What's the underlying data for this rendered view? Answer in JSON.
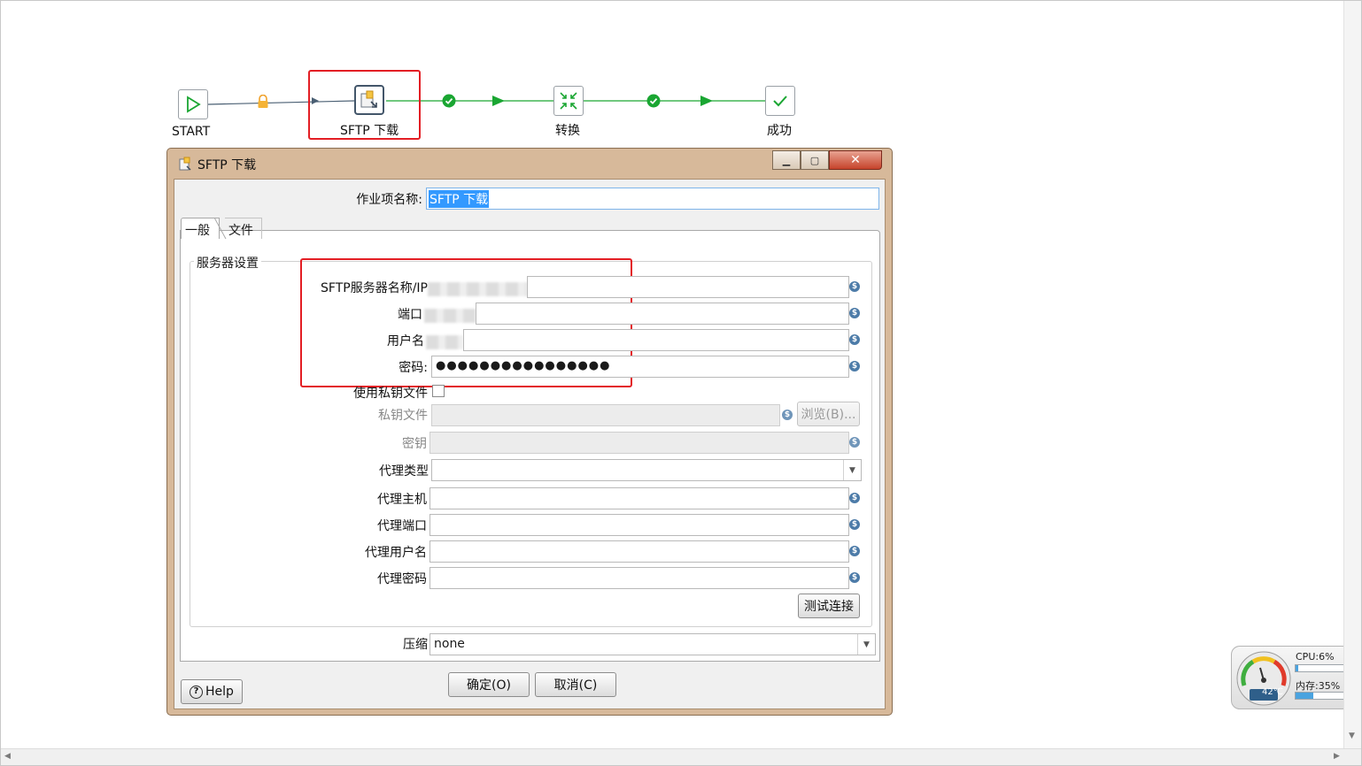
{
  "workflow": {
    "nodes": [
      {
        "label": "START",
        "icon": "play-icon"
      },
      {
        "label": "SFTP 下载",
        "icon": "sftp-download-icon"
      },
      {
        "label": "转换",
        "icon": "transform-icon"
      },
      {
        "label": "成功",
        "icon": "checkmark-icon"
      }
    ]
  },
  "dialog": {
    "title": "SFTP 下载",
    "job_name_label": "作业项名称:",
    "job_name_value": "SFTP 下载",
    "tabs": [
      {
        "label": "一般"
      },
      {
        "label": "文件"
      }
    ],
    "group_title": "服务器设置",
    "fields": {
      "server_label": "SFTP服务器名称/IP",
      "port_label": "端口",
      "username_label": "用户名",
      "password_label": "密码:",
      "password_value": "●●●●●●●●●●●●●●●●",
      "use_key_label": "使用私钥文件",
      "key_file_label": "私钥文件",
      "browse_label": "浏览(B)...",
      "passphrase_label": "密钥",
      "proxy_type_label": "代理类型",
      "proxy_host_label": "代理主机",
      "proxy_port_label": "代理端口",
      "proxy_user_label": "代理用户名",
      "proxy_password_label": "代理密码",
      "test_connection_label": "测试连接"
    },
    "compression_label": "压缩",
    "compression_value": "none",
    "help_label": "Help",
    "ok_label": "确定(O)",
    "cancel_label": "取消(C)"
  },
  "perf_widget": {
    "cpu_label": "CPU:6%",
    "cpu_fraction": 0.06,
    "mem_label": "内存:35%",
    "mem_fraction": 0.35,
    "temp_label": "42℃"
  },
  "colors": {
    "highlight": "#e31e24",
    "hop_green": "#1aa632",
    "selection": "#3399ff"
  }
}
